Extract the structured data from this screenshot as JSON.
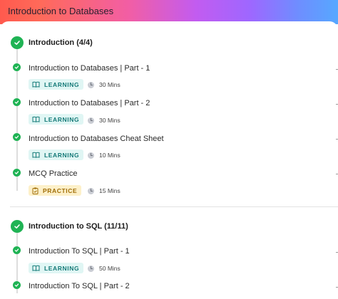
{
  "header": {
    "title": "Introduction to Databases"
  },
  "sections": [
    {
      "title": "Introduction (4/4)",
      "items": [
        {
          "title": "Introduction to Databases | Part - 1",
          "badge": "LEARNING",
          "duration": "30 Mins"
        },
        {
          "title": "Introduction to Databases | Part - 2",
          "badge": "LEARNING",
          "duration": "30 Mins"
        },
        {
          "title": "Introduction to Databases Cheat Sheet",
          "badge": "LEARNING",
          "duration": "10 Mins"
        },
        {
          "title": "MCQ Practice",
          "badge": "PRACTICE",
          "duration": "15 Mins"
        }
      ]
    },
    {
      "title": "Introduction to SQL (11/11)",
      "items": [
        {
          "title": "Introduction To SQL | Part - 1",
          "badge": "LEARNING",
          "duration": "50 Mins"
        },
        {
          "title": "Introduction To SQL | Part - 2"
        }
      ]
    }
  ],
  "icons": {
    "section_status": "check-circle-icon",
    "item_status": "check-circle-icon",
    "learning_badge": "book-icon",
    "practice_badge": "clipboard-icon",
    "duration": "clock-icon"
  },
  "colors": {
    "complete": "#1fb354",
    "learning_bg": "#e0f6f4",
    "learning_text": "#157a78",
    "practice_bg": "#fdf0c9",
    "practice_text": "#a06d07"
  }
}
